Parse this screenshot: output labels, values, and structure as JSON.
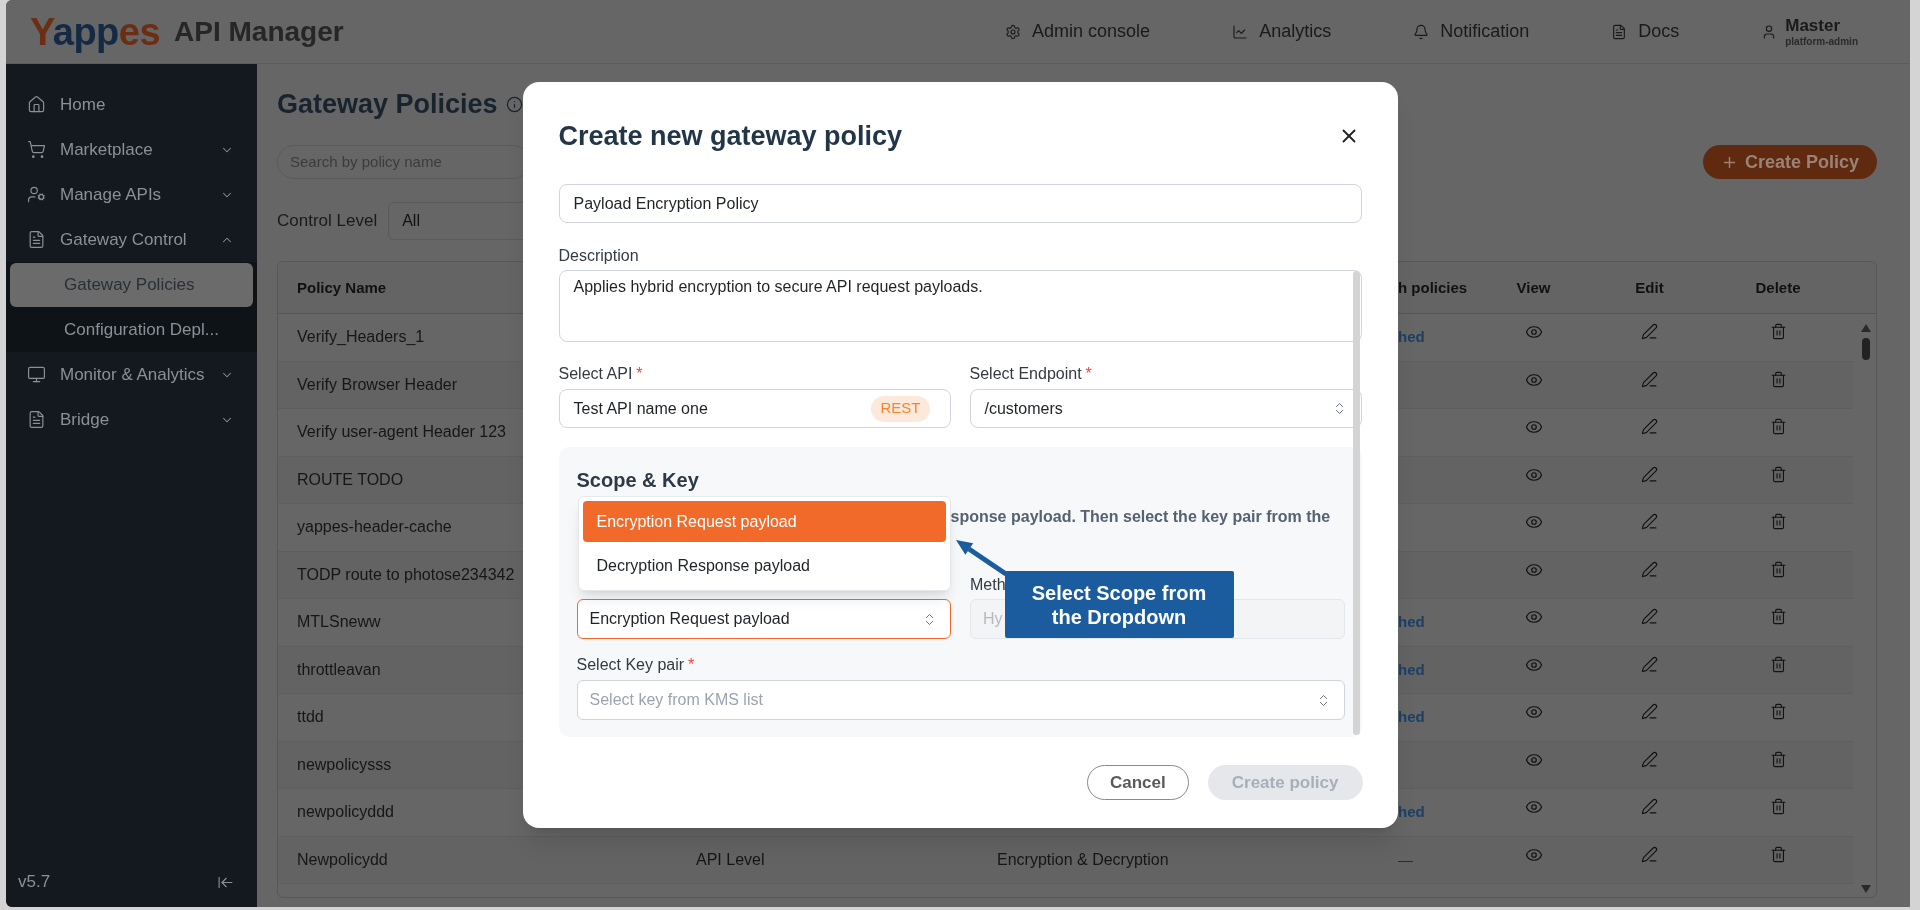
{
  "topbar": {
    "logo": "Yappes",
    "product": "API Manager",
    "nav": [
      {
        "label": "Admin console"
      },
      {
        "label": "Analytics"
      },
      {
        "label": "Notification"
      },
      {
        "label": "Docs"
      }
    ],
    "user": {
      "name": "Master",
      "role": "platform-admin"
    }
  },
  "sidebar": {
    "items": [
      {
        "label": "Home",
        "kind": "link"
      },
      {
        "label": "Marketplace",
        "kind": "group",
        "expanded": false
      },
      {
        "label": "Manage APIs",
        "kind": "group",
        "expanded": false
      },
      {
        "label": "Gateway Control",
        "kind": "group",
        "expanded": true,
        "children": [
          {
            "label": "Gateway Policies",
            "selected": true
          },
          {
            "label": "Configuration Depl...",
            "selected": false
          }
        ]
      },
      {
        "label": "Monitor & Analytics",
        "kind": "group",
        "expanded": false
      },
      {
        "label": "Bridge",
        "kind": "group",
        "expanded": false
      }
    ],
    "version": "v5.7"
  },
  "page": {
    "title": "Gateway Policies",
    "search": {
      "placeholder": "Search by policy name"
    },
    "filter": {
      "label": "Control Level",
      "value": "All"
    },
    "create_button": {
      "label": "Create Policy"
    }
  },
  "table": {
    "headers": {
      "policy_name": "Policy Name",
      "column_4": "h policies",
      "view": "View",
      "edit": "Edit",
      "delete": "Delete"
    },
    "rows": [
      {
        "policy_name": "Verify_Headers_1",
        "column_4": {
          "text": "hed",
          "kind": "link"
        }
      },
      {
        "policy_name": "Verify Browser Header"
      },
      {
        "policy_name": "Verify user-agent Header 123"
      },
      {
        "policy_name": "ROUTE TODO"
      },
      {
        "policy_name": "yappes-header-cache"
      },
      {
        "policy_name": "TODP route to photose234342"
      },
      {
        "policy_name": "MTLSneww",
        "column_4": {
          "text": "hed",
          "kind": "link"
        }
      },
      {
        "policy_name": "throttleavan",
        "column_4": {
          "text": "hed",
          "kind": "link"
        }
      },
      {
        "policy_name": "ttdd",
        "column_4": {
          "text": "hed",
          "kind": "link"
        }
      },
      {
        "policy_name": "newpolicysss"
      },
      {
        "policy_name": "newpolicyddd",
        "column_4": {
          "text": "hed",
          "kind": "link"
        }
      },
      {
        "policy_name": "Newpolicydd",
        "column_2": "API Level",
        "column_3": "Encryption & Decryption",
        "column_4": {
          "text": "—",
          "kind": "plain"
        }
      }
    ]
  },
  "modal": {
    "title": "Create new gateway policy",
    "name_field": {
      "value": "Payload Encryption Policy"
    },
    "description": {
      "label": "Description",
      "value": "Applies hybrid encryption to secure API request payloads."
    },
    "api": {
      "label": "Select API",
      "required_mark": "*",
      "value": "Test API name one",
      "badge": "REST"
    },
    "endpoint": {
      "label": "Select Endpoint",
      "required_mark": "*",
      "value": "/customers"
    },
    "scope_key": {
      "title": "Scope & Key",
      "hint": "sponse payload. Then select the key pair from the",
      "scope": {
        "value": "Encryption Request payload",
        "focused": true,
        "expanded": true,
        "options": [
          {
            "label": "Encryption Request payload",
            "selected": true
          },
          {
            "label": "Decryption Response payload",
            "selected": false
          }
        ]
      },
      "method": {
        "label": "Meth",
        "placeholder": "Hy",
        "disabled": true
      },
      "key_pair": {
        "label": "Select Key pair",
        "required_mark": "*",
        "placeholder": "Select key from KMS list"
      }
    },
    "buttons": [
      {
        "label": "Cancel",
        "kind": "secondary",
        "disabled": false
      },
      {
        "label": "Create policy",
        "kind": "primary",
        "disabled": true
      }
    ]
  },
  "annotation": {
    "text": "Select Scope from the Dropdown"
  }
}
